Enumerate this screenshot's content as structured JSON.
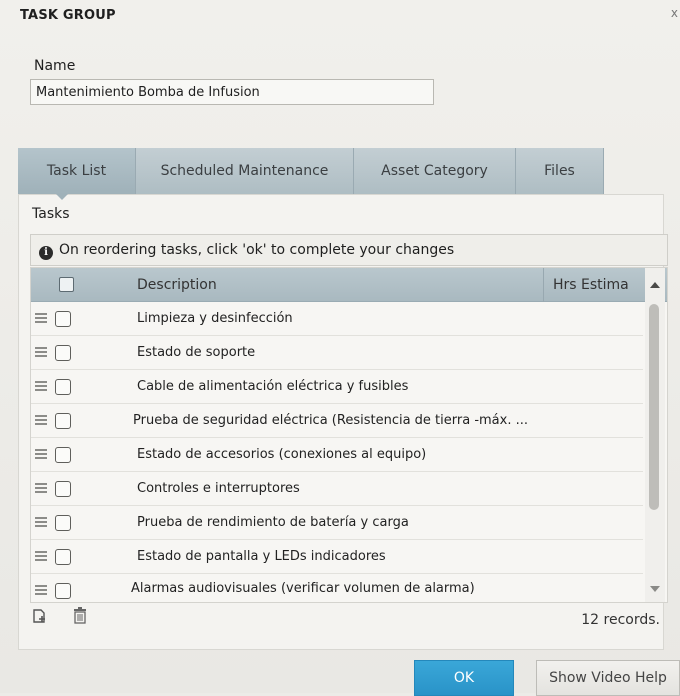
{
  "dialog": {
    "title": "TASK GROUP",
    "close_glyph": "x"
  },
  "name": {
    "label": "Name",
    "value": "Mantenimiento Bomba de Infusion"
  },
  "tabs": [
    {
      "label": "Task List",
      "active": true
    },
    {
      "label": "Scheduled Maintenance",
      "active": false
    },
    {
      "label": "Asset Category",
      "active": false
    },
    {
      "label": "Files",
      "active": false
    }
  ],
  "tasks": {
    "section_label": "Tasks",
    "info_message": "On reordering tasks, click 'ok' to complete your changes",
    "columns": {
      "description": "Description",
      "hrs": "Hrs Estima"
    },
    "rows": [
      {
        "description": "Limpieza y desinfección"
      },
      {
        "description": "Estado de soporte"
      },
      {
        "description": "Cable de alimentación eléctrica y fusibles"
      },
      {
        "description": "Prueba de seguridad eléctrica (Resistencia de tierra -máx. ..."
      },
      {
        "description": "Estado de accesorios (conexiones al equipo)"
      },
      {
        "description": "Controles e interruptores"
      },
      {
        "description": "Prueba de rendimiento de batería y carga"
      },
      {
        "description": "Estado de pantalla y LEDs indicadores"
      },
      {
        "description": "Alarmas audiovisuales (verificar volumen de alarma)"
      }
    ],
    "records_text": "12 records."
  },
  "buttons": {
    "ok": "OK",
    "help": "Show Video Help"
  },
  "colors": {
    "ok_button": "#2993c8",
    "tab_bg": "#aebdc3",
    "header_bg": "#a9b9c0"
  }
}
